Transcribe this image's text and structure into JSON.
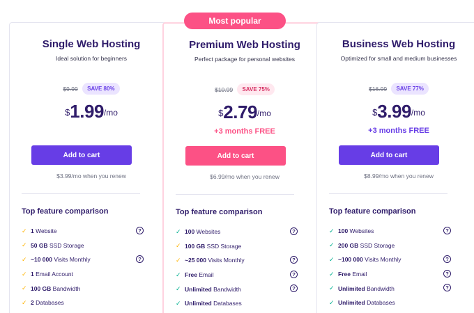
{
  "badge": "Most popular",
  "plans": [
    {
      "title": "Single Web Hosting",
      "description": "Ideal solution for beginners",
      "old_price": "$9.99",
      "save": "SAVE 80%",
      "currency": "$",
      "price": "1.99",
      "period": "/mo",
      "promo": "",
      "cta": "Add to cart",
      "renew": "$3.99/mo when you renew",
      "features_title": "Top feature comparison",
      "features": [
        {
          "strong": "1",
          "text": " Website",
          "check": "yellow",
          "help": true
        },
        {
          "strong": "50 GB",
          "text": " SSD Storage",
          "check": "yellow",
          "help": false
        },
        {
          "strong": "~10 000",
          "text": " Visits Monthly",
          "check": "yellow",
          "help": true
        },
        {
          "strong": "1",
          "text": " Email Account",
          "check": "yellow",
          "help": false
        },
        {
          "strong": "100 GB",
          "text": " Bandwidth",
          "check": "yellow",
          "help": false
        },
        {
          "strong": "2",
          "text": " Databases",
          "check": "yellow",
          "help": false
        }
      ]
    },
    {
      "title": "Premium Web Hosting",
      "description": "Perfect package for personal websites",
      "old_price": "$10.99",
      "save": "SAVE 75%",
      "currency": "$",
      "price": "2.79",
      "period": "/mo",
      "promo": "+3 months FREE",
      "cta": "Add to cart",
      "renew": "$6.99/mo when you renew",
      "features_title": "Top feature comparison",
      "features": [
        {
          "strong": "100",
          "text": " Websites",
          "check": "green",
          "help": true
        },
        {
          "strong": "100 GB",
          "text": " SSD Storage",
          "check": "yellow",
          "help": false
        },
        {
          "strong": "~25 000",
          "text": " Visits Monthly",
          "check": "yellow",
          "help": true
        },
        {
          "strong": "Free",
          "text": " Email",
          "check": "green",
          "help": true
        },
        {
          "strong": "Unlimited",
          "text": " Bandwidth",
          "check": "green",
          "help": true
        },
        {
          "strong": "Unlimited",
          "text": " Databases",
          "check": "green",
          "help": false
        }
      ]
    },
    {
      "title": "Business Web Hosting",
      "description": "Optimized for small and medium businesses",
      "old_price": "$16.99",
      "save": "SAVE 77%",
      "currency": "$",
      "price": "3.99",
      "period": "/mo",
      "promo": "+3 months FREE",
      "cta": "Add to cart",
      "renew": "$8.99/mo when you renew",
      "features_title": "Top feature comparison",
      "features": [
        {
          "strong": "100",
          "text": " Websites",
          "check": "green",
          "help": true
        },
        {
          "strong": "200 GB",
          "text": " SSD Storage",
          "check": "green",
          "help": false
        },
        {
          "strong": "~100 000",
          "text": " Visits Monthly",
          "check": "green",
          "help": true
        },
        {
          "strong": "Free",
          "text": " Email",
          "check": "green",
          "help": true
        },
        {
          "strong": "Unlimited",
          "text": " Bandwidth",
          "check": "green",
          "help": true
        },
        {
          "strong": "Unlimited",
          "text": " Databases",
          "check": "green",
          "help": false
        }
      ]
    }
  ],
  "colors": {
    "primary": "#673de6",
    "accent_pink": "#fc5185",
    "text_dark": "#2f1c6a",
    "check_yellow": "#ffb300",
    "check_green": "#00b090"
  },
  "icons": {
    "check": "check-icon",
    "help": "help-circle-icon"
  }
}
